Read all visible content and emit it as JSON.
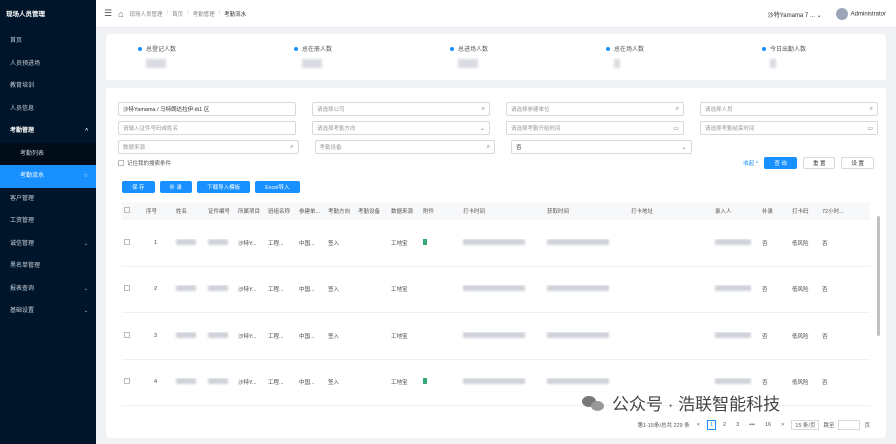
{
  "sidebar": {
    "title": "现场人员管理",
    "items": [
      {
        "label": "首页",
        "chevron": ""
      },
      {
        "label": "人员预进场",
        "chevron": ""
      },
      {
        "label": "教育培训",
        "chevron": ""
      },
      {
        "label": "人员信息",
        "chevron": ""
      },
      {
        "label": "考勤管理",
        "chevron": "^"
      },
      {
        "label": "考勤列表",
        "chevron": ""
      },
      {
        "label": "考勤流水",
        "chevron": "☆"
      },
      {
        "label": "客户管理",
        "chevron": ""
      },
      {
        "label": "工资管理",
        "chevron": ""
      },
      {
        "label": "诚信管理",
        "chevron": "⌄"
      },
      {
        "label": "黑名单管理",
        "chevron": ""
      },
      {
        "label": "报表查询",
        "chevron": "⌄"
      },
      {
        "label": "基础设置",
        "chevron": "⌄"
      }
    ]
  },
  "header": {
    "breadcrumbs": [
      "现场人员管理",
      "首页",
      "考勤管理",
      "考勤流水"
    ],
    "project": "沙特Yamama 7 ...",
    "project_chevron": "⌄",
    "user": "Administrator"
  },
  "stats": [
    {
      "label": "总登记人数"
    },
    {
      "label": "总在册人数"
    },
    {
      "label": "总进场人数"
    },
    {
      "label": "总在场人数"
    },
    {
      "label": "今日出勤人数"
    }
  ],
  "filters": {
    "row1": [
      {
        "text": "沙特Yamama / 马特朗达拉伊-ib1 区",
        "icon": "",
        "filled": true
      },
      {
        "text": "请选择公司",
        "icon": "⌕"
      },
      {
        "text": "请选择参建单位",
        "icon": "⌕"
      },
      {
        "text": "请选择人员",
        "icon": "⌕"
      }
    ],
    "row2": [
      {
        "text": "请输入证件号码或姓名",
        "icon": ""
      },
      {
        "text": "请选择考勤方向",
        "icon": "⌄"
      },
      {
        "text": "请选择考勤开始时间",
        "icon": "▭"
      },
      {
        "text": "请选择考勤结束时间",
        "icon": "▭"
      }
    ],
    "row3": [
      {
        "text": "数据来源",
        "icon": "⌕"
      },
      {
        "text": "考勤设备",
        "icon": "⌕"
      },
      {
        "text": "否",
        "icon": "⌄",
        "filled": true
      }
    ],
    "remember": "记住我的搜索条件"
  },
  "actions": {
    "collapse": "收起 ^",
    "query": "查 询",
    "reset": "重 置",
    "settings": "设 置"
  },
  "toolbar": [
    "保 存",
    "补 录",
    "下载导入模板",
    "Excel导入"
  ],
  "table": {
    "columns": [
      "序号",
      "姓名",
      "证件编号",
      "所属项目",
      "班组名称",
      "参建单...",
      "考勤方向",
      "考勤设备",
      "数据来源",
      "附件",
      "打卡时间",
      "获取时间",
      "打卡地址",
      "录入人",
      "补录",
      "打卡码",
      "72小时..."
    ],
    "rows": [
      {
        "index": "1",
        "project": "沙特Y...",
        "team": "工程...",
        "unit": "中国...",
        "direction": "签入",
        "source": "工地宝",
        "supplement": "否",
        "code": "低风险",
        "h72": "否"
      },
      {
        "index": "2",
        "project": "沙特Y...",
        "team": "工程...",
        "unit": "中国...",
        "direction": "签入",
        "source": "工地宝",
        "supplement": "否",
        "code": "低风险",
        "h72": "否"
      },
      {
        "index": "3",
        "project": "沙特Y...",
        "team": "工程...",
        "unit": "中国...",
        "direction": "签入",
        "source": "工地宝",
        "supplement": "否",
        "code": "低风险",
        "h72": "否"
      },
      {
        "index": "4",
        "project": "沙特Y...",
        "team": "工程...",
        "unit": "中国...",
        "direction": "签入",
        "source": "工地宝",
        "supplement": "否",
        "code": "低风险",
        "h72": "否"
      }
    ]
  },
  "pagination": {
    "summary": "第1-15条/总共 229 条",
    "prev": "<",
    "pages": [
      "1",
      "2",
      "3",
      "•••",
      "16"
    ],
    "next": ">",
    "page_size": "15 条/页",
    "goto": "跳至",
    "page_unit": "页"
  },
  "watermark": "公众号 · 浩联智能科技"
}
